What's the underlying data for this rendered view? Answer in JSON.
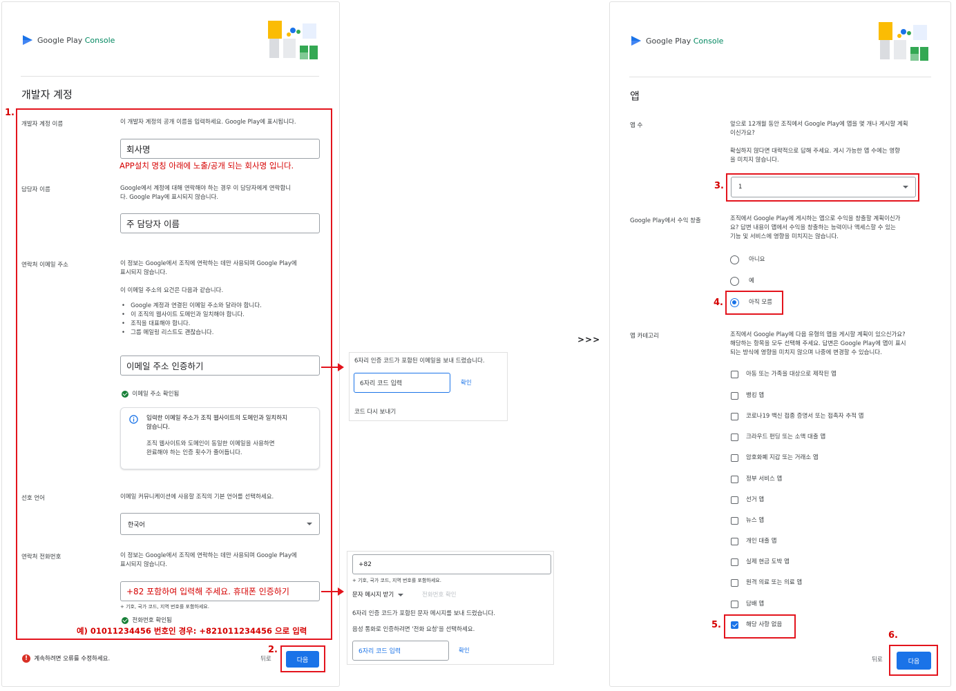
{
  "brand": {
    "name_a": "Google Play",
    "name_b": "Console"
  },
  "left": {
    "title": "개발자 계정",
    "step1": "1.",
    "dev_name": {
      "label": "개발자 계정 이름",
      "desc": "이 개발자 계정의 공개 이름을 입력하세요. Google Play에 표시됩니다.",
      "value": "회사명",
      "note": "APP설치 명칭 아래에 노출/공개 되는 회사명 입니다."
    },
    "contact_name": {
      "label": "담당자 이름",
      "desc1": "Google에서 계정에 대해 연락해야 하는 경우 이 담당자에게 연락합니",
      "desc2": "다. Google Play에 표시되지 않습니다.",
      "value": "주 담당자 이름"
    },
    "email": {
      "label": "연락처 이메일 주소",
      "desc1": "이 정보는 Google에서 조직에 연락하는 데만 사용되며 Google Play에",
      "desc2": "표시되지 않습니다.",
      "req": "이 이메일 주소의 요건은 다음과 같습니다.",
      "bullets": [
        "Google 계정과 연결된 이메일 주소와 달라야 합니다.",
        "이 조직의 웹사이트 도메인과 일치해야 합니다.",
        "조직을 대표해야 합니다.",
        "그룹 메일링 리스트도 괜찮습니다."
      ],
      "value": "이메일 주소 인증하기",
      "verified": "이메일 주소 확인됨",
      "info1": "입력한 이메일 주소가 조직 웹사이트의 도메인과 일치하지",
      "info2": "않습니다.",
      "info3": "조직 웹사이트와 도메인이 동일한 이메일을 사용하면",
      "info4": "완료해야 하는 인증 횟수가 줄어듭니다."
    },
    "lang": {
      "label": "선호 언어",
      "desc": "이메일 커뮤니케이션에 사용할 조직의 기본 언어를 선택하세요.",
      "value": "한국어"
    },
    "phone": {
      "label": "연락처 전화번호",
      "desc1": "이 정보는 Google에서 조직에 연락하는 데만 사용되며 Google Play에",
      "desc2": "표시되지 않습니다.",
      "value": "+82 포함하여 입력해 주세요. 휴대폰 인증하기",
      "hint": "+ 기호, 국가 코드, 지역 번호를 포함하세요.",
      "verified": "전화번호 확인됨",
      "example": "예) 01011234456 번호인 경우: +821011234456 으로 입력"
    },
    "error": "계속하려면 오류를 수정하세요.",
    "back": "뒤로",
    "step2": "2.",
    "next": "다음"
  },
  "email_popup": {
    "sent": "6자리 인증 코드가 포함된 이메일을 보내 드렸습니다.",
    "placeholder": "6자리 코드 입력",
    "confirm": "확인",
    "resend": "코드 다시 보내기"
  },
  "phone_popup": {
    "value": "+82",
    "hint": "+ 기호, 국가 코드, 지역 번호를 포함하세요.",
    "method": "문자 메시지 받기",
    "verify": "전화번호 확인",
    "sent": "6자리 인증 코드가 포함된 문자 메시지를 보내 드렸습니다.",
    "voice": "음성 통화로 인증하려면 '전화 요청'을 선택하세요.",
    "placeholder": "6자리 코드 입력",
    "confirm": "확인"
  },
  "separator": ">>>",
  "right": {
    "title": "앱",
    "app_count": {
      "label": "앱 수",
      "q1": "앞으로 12개월 동안 조직에서 Google Play에 앱을 몇 개나 게시할 계획",
      "q2": "이신가요?",
      "q3": "확실하지 않다면 대략적으로 답해 주세요. 게시 가능한 앱 수에는 영향",
      "q4": "을 미치지 않습니다.",
      "value": "1"
    },
    "step3": "3.",
    "monetize": {
      "label": "Google Play에서 수익 창출",
      "q1": "조직에서 Google Play에 게시하는 앱으로 수익을 창출할 계획이신가",
      "q2": "요? 답변 내용이 앱에서 수익을 창출하는 능력이나 액세스할 수 있는",
      "q3": "기능 및 서비스에 영향을 미치지는 않습니다.",
      "options": [
        "아니요",
        "예",
        "아직 모름"
      ]
    },
    "step4": "4.",
    "category": {
      "label": "앱 카테고리",
      "q1": "조직에서 Google Play에 다음 유형의 앱을 게시할 계획이 있으신가요?",
      "q2": "해당하는 항목을 모두 선택해 주세요. 답변은 Google Play에 앱이 표시",
      "q3": "되는 방식에 영향을 미치지 않으며 나중에 변경할 수 있습니다.",
      "options": [
        "아동 또는 가족을 대상으로 제작된 앱",
        "뱅킹 앱",
        "코로나19 백신 접종 증명서 또는 접촉자 추적 앱",
        "크라우드 펀딩 또는 소액 대출 앱",
        "암호화폐 지갑 또는 거래소 앱",
        "정부 서비스 앱",
        "선거 앱",
        "뉴스 앱",
        "개인 대출 앱",
        "실제 현금 도박 앱",
        "원격 의료 또는 의료 앱",
        "담배 앱",
        "해당 사항 없음"
      ]
    },
    "step5": "5.",
    "back": "뒤로",
    "step6": "6.",
    "next": "다음"
  },
  "colors": {
    "accent": "#1a73e8",
    "annotation": "#e3131c",
    "success": "#188038",
    "error": "#d93025"
  }
}
